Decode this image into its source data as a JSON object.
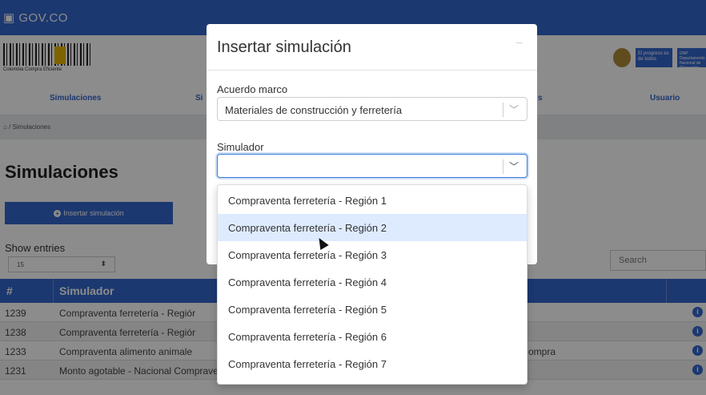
{
  "gov_bar": {
    "logo": "GOV.CO"
  },
  "brand": {
    "caption": "Colombia Compra Eficiente",
    "progreso": "El progreso es de todos",
    "dnp": "DNP Departamento Nacional de Planeación"
  },
  "nav": {
    "items": [
      "Simulaciones",
      "Si",
      "s",
      "Usuario"
    ]
  },
  "breadcrumb": {
    "home_icon": "home-icon",
    "separator": "/",
    "current": "Simulaciones"
  },
  "page": {
    "title": "Simulaciones",
    "insert_button": "Insertar simulación",
    "show_entries": "Show entries",
    "entries_value": "15",
    "search_placeholder": "Search"
  },
  "table": {
    "headers": [
      "#",
      "Simulador"
    ],
    "rows": [
      {
        "id": "1239",
        "simulador": "Compraventa ferretería - Regiór",
        "extra": ""
      },
      {
        "id": "1238",
        "simulador": "Compraventa ferretería - Regiór",
        "extra": ""
      },
      {
        "id": "1233",
        "simulador": "Compraventa alimento animale",
        "extra": "ompra"
      },
      {
        "id": "1231",
        "simulador": "Monto agotable - Nacional Compraventa - Lote",
        "extra": ""
      }
    ]
  },
  "modal": {
    "title": "Insertar simulación",
    "close": "–",
    "acuerdo_label": "Acuerdo marco",
    "acuerdo_value": "Materiales de construcción y ferretería",
    "simulador_label": "Simulador",
    "simulador_value": ""
  },
  "dropdown": {
    "options": [
      "Compraventa ferretería - Región 1",
      "Compraventa ferretería - Región 2",
      "Compraventa ferretería - Región 3",
      "Compraventa ferretería - Región 4",
      "Compraventa ferretería - Región 5",
      "Compraventa ferretería - Región 6",
      "Compraventa ferretería - Región 7"
    ],
    "hovered_index": 1
  },
  "colors": {
    "brand_blue": "#3366cc",
    "hover": "#deebff",
    "focus": "#3d7bd6"
  }
}
